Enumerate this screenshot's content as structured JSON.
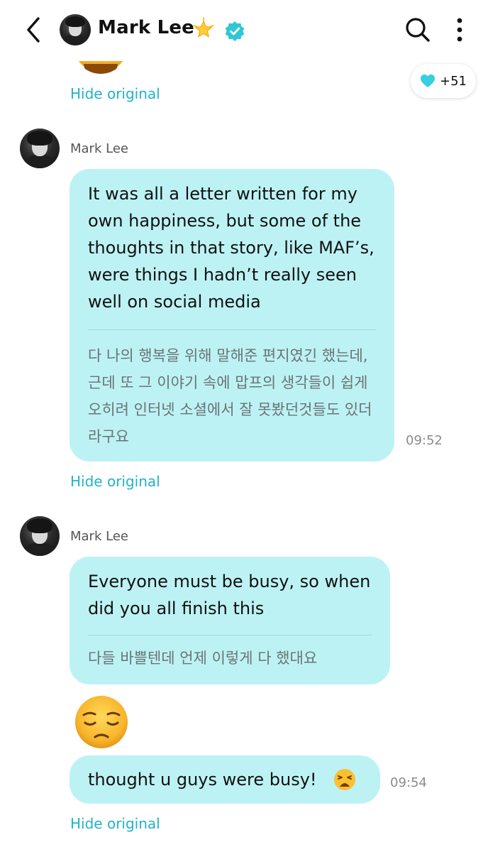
{
  "header": {
    "contact_name": "Mark Lee",
    "icons": [
      "back-chevron-icon",
      "avatar",
      "glowing-star-icon",
      "verified-badge-icon",
      "search-icon",
      "more-vertical-icon"
    ]
  },
  "reaction": {
    "icon": "heart-icon",
    "color": "#36d0e0",
    "count": "+51"
  },
  "hide_original_label": "Hide original",
  "colors": {
    "bubble": "#bdf2f5",
    "link": "#22b3c7",
    "timestamp": "#8b8b8b"
  },
  "messages": [
    {
      "sender": "Mark Lee",
      "english": "It was all a letter written for my own happiness, but some of the thoughts in that story, like MAF’s, were things I hadn’t really seen well on social media",
      "korean": "다 나의 행복을 위해 말해준 편지였긴 했는데, 근데 또 그 이야기 속에 맙프의 생각들이 쉽게 오히려 인터넷 소셜에서 잘 못봤던것들도 있더라구요",
      "time": "09:52"
    },
    {
      "sender": "Mark Lee",
      "english": "Everyone must be busy, so when did you all finish this",
      "korean": "다들 바쁠텐데 언제 이렇게 다 했대요"
    },
    {
      "emoji": "pensive-face-emoji",
      "english": "thought u guys were busy!",
      "trailing_emoji": "weary-face-emoji",
      "time": "09:54"
    }
  ]
}
